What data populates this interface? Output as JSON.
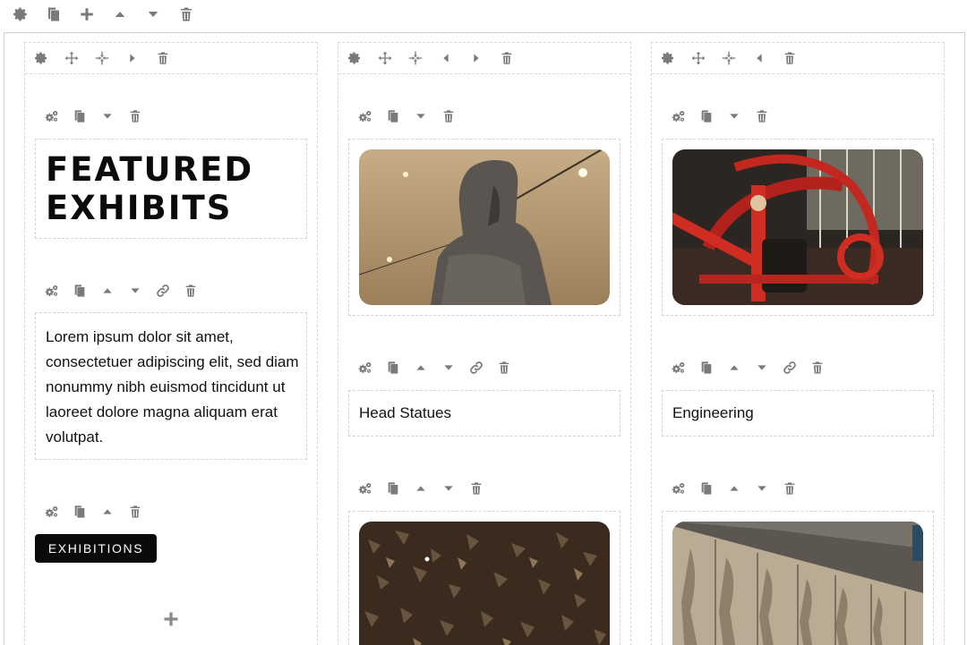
{
  "heading": {
    "line1": "FEATURED",
    "line2": "EXHIBITS"
  },
  "paragraph": "Lorem ipsum dolor sit amet, consectetuer adipiscing elit, sed diam nonummy nibh euismod tincidunt ut laoreet dolore magna aliquam erat volutpat.",
  "button": {
    "label": "EXHIBITIONS"
  },
  "captions": {
    "col2": "Head Statues",
    "col3": "Engineering"
  },
  "icons": {
    "settings": "gear-icon",
    "block_settings": "gears-icon",
    "copy": "copy-icon",
    "add": "plus-icon",
    "up": "caret-up-icon",
    "down": "caret-down-icon",
    "left": "caret-left-icon",
    "right": "caret-right-icon",
    "move": "move-icon",
    "resize": "compress-icon",
    "link": "link-icon",
    "delete": "trash-icon"
  },
  "colors": {
    "icon": "#7a7a7a",
    "button_bg": "#0a0a0a",
    "button_text": "#ffffff",
    "border": "#d2d2d2"
  }
}
